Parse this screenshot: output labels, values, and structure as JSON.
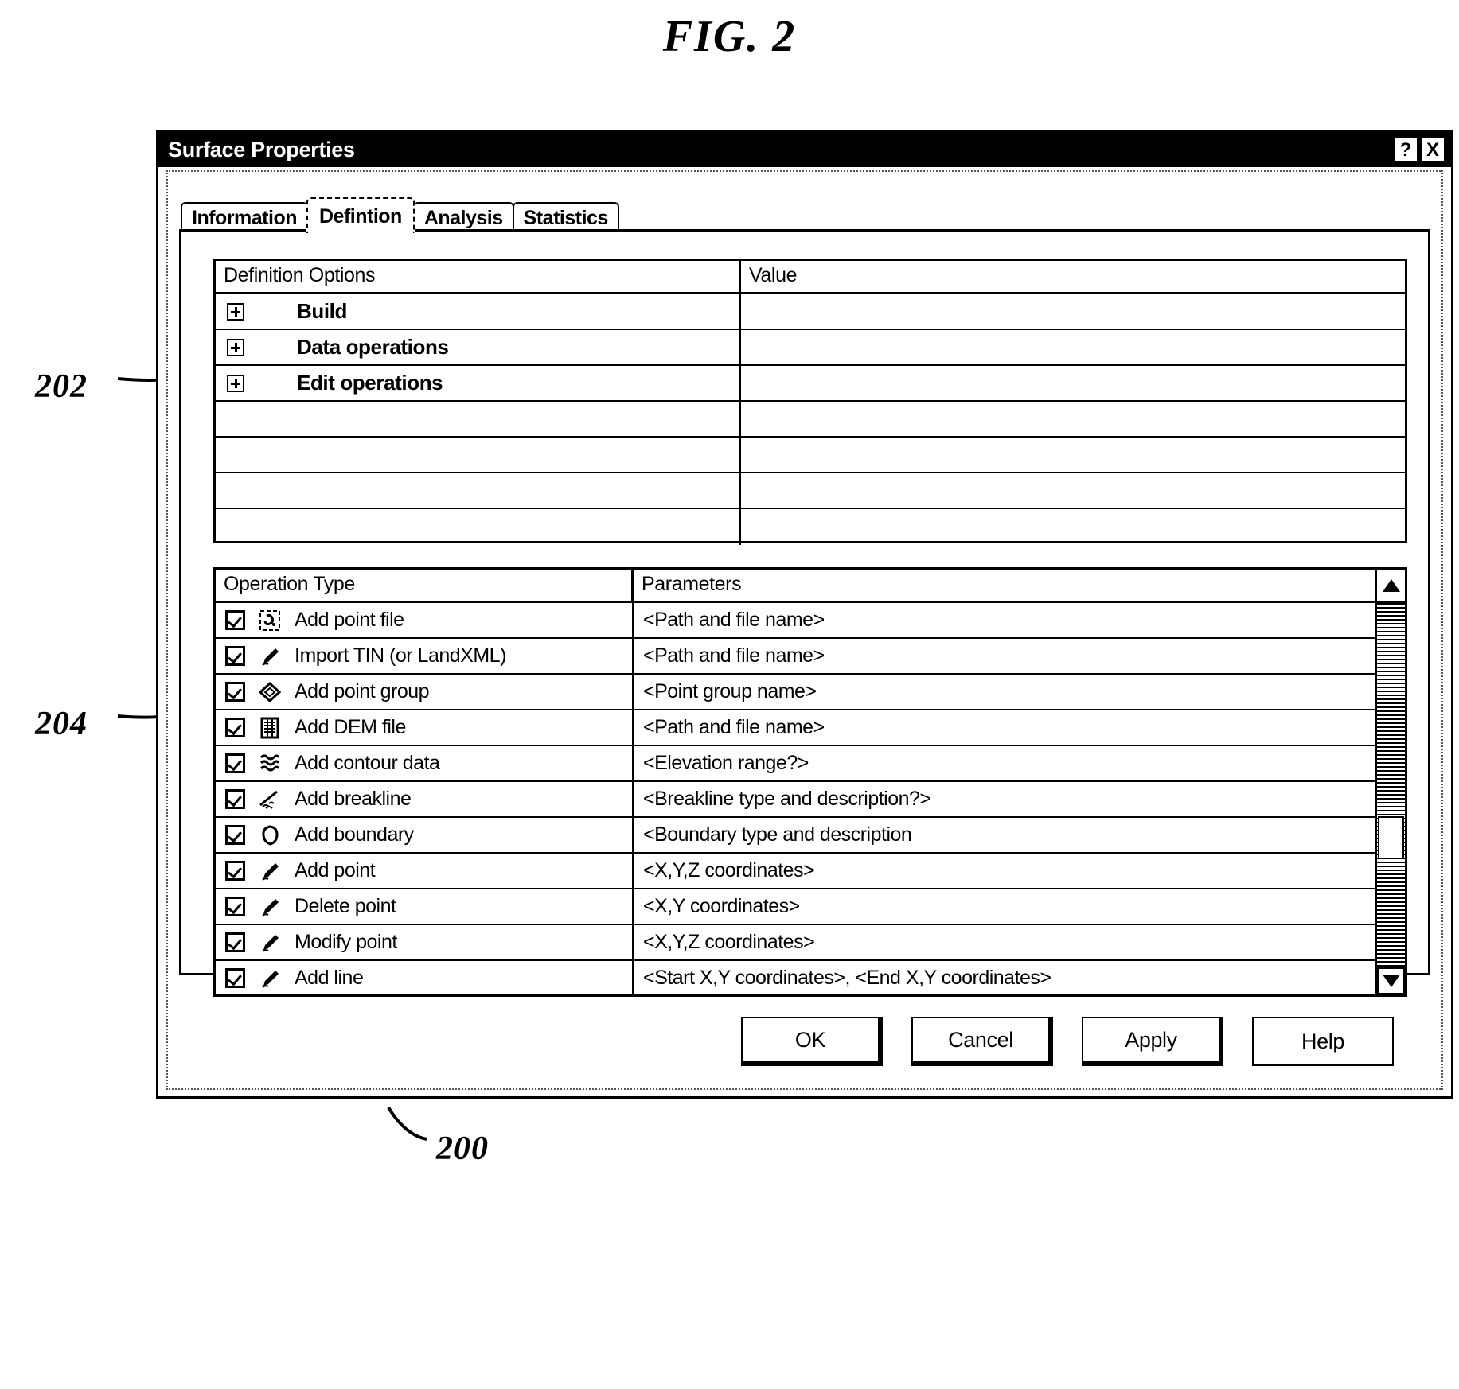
{
  "figure": {
    "label": "FIG. 2"
  },
  "callouts": [
    {
      "id": "202",
      "text": "202"
    },
    {
      "id": "204",
      "text": "204"
    },
    {
      "id": "200",
      "text": "200"
    }
  ],
  "dialog": {
    "title": "Surface Properties",
    "title_buttons": [
      {
        "name": "help-button",
        "glyph": "?"
      },
      {
        "name": "close-button",
        "glyph": "X"
      }
    ],
    "tabs": [
      {
        "label": "Information",
        "active": false
      },
      {
        "label": "Defintion",
        "active": true
      },
      {
        "label": "Analysis",
        "active": false
      },
      {
        "label": "Statistics",
        "active": false
      }
    ],
    "definition_grid": {
      "columns": [
        "Definition Options",
        "Value"
      ],
      "rows": [
        {
          "label": "Build",
          "value": "",
          "expandable": true
        },
        {
          "label": "Data operations",
          "value": "",
          "expandable": true
        },
        {
          "label": "Edit operations",
          "value": "",
          "expandable": true
        },
        {
          "label": "",
          "value": "",
          "expandable": false
        },
        {
          "label": "",
          "value": "",
          "expandable": false
        },
        {
          "label": "",
          "value": "",
          "expandable": false
        },
        {
          "label": "",
          "value": "",
          "expandable": false
        }
      ]
    },
    "operations_grid": {
      "columns": [
        "Operation Type",
        "Parameters"
      ],
      "rows": [
        {
          "checked": true,
          "icon": "point-file-icon",
          "operation": "Add point file",
          "parameters": "<Path and file name>"
        },
        {
          "checked": true,
          "icon": "pencil-icon",
          "operation": "Import TIN (or LandXML)",
          "parameters": "<Path and file name>"
        },
        {
          "checked": true,
          "icon": "point-group-icon",
          "operation": "Add point group",
          "parameters": "<Point group name>"
        },
        {
          "checked": true,
          "icon": "dem-file-icon",
          "operation": "Add DEM file",
          "parameters": "<Path and file name>"
        },
        {
          "checked": true,
          "icon": "contour-icon",
          "operation": "Add contour data",
          "parameters": "<Elevation range?>"
        },
        {
          "checked": true,
          "icon": "breakline-icon",
          "operation": "Add breakline",
          "parameters": "<Breakline type and description?>"
        },
        {
          "checked": true,
          "icon": "boundary-icon",
          "operation": "Add boundary",
          "parameters": "<Boundary type and description"
        },
        {
          "checked": true,
          "icon": "pencil-icon",
          "operation": "Add point",
          "parameters": "<X,Y,Z coordinates>"
        },
        {
          "checked": true,
          "icon": "pencil-icon",
          "operation": "Delete point",
          "parameters": "<X,Y coordinates>"
        },
        {
          "checked": true,
          "icon": "pencil-icon",
          "operation": "Modify point",
          "parameters": "<X,Y,Z coordinates>"
        },
        {
          "checked": true,
          "icon": "pencil-icon",
          "operation": "Add line",
          "parameters": "<Start X,Y coordinates>, <End X,Y coordinates>"
        }
      ],
      "scrollbar": {
        "up_icon": "scroll-up-arrow-icon",
        "down_icon": "scroll-down-arrow-icon"
      }
    },
    "buttons": [
      {
        "name": "ok-button",
        "label": "OK"
      },
      {
        "name": "cancel-button",
        "label": "Cancel"
      },
      {
        "name": "apply-button",
        "label": "Apply"
      },
      {
        "name": "help-button",
        "label": "Help"
      }
    ]
  }
}
